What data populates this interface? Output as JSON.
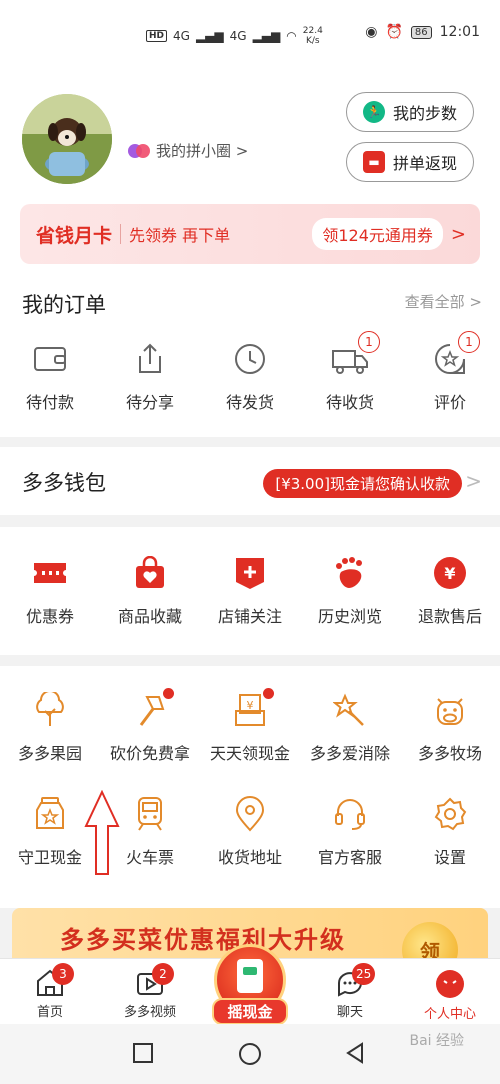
{
  "status_bar": {
    "network_left": "HD",
    "signal1": "4G",
    "signal2": "4G",
    "speed_value": "22.4",
    "speed_unit": "K/s",
    "battery": "86",
    "time": "12:01"
  },
  "profile": {
    "circle_link": "我的拼小圈 >",
    "steps_button": "我的步数",
    "cashback_button": "拼单返现",
    "vip": {
      "title": "省钱月卡",
      "subtitle": "先领券 再下单",
      "coupon": "领124元通用券",
      "arrow": ">"
    }
  },
  "orders": {
    "title": "我的订单",
    "view_all": "查看全部 >",
    "items": [
      {
        "label": "待付款",
        "icon": "wallet-icon",
        "badge": null
      },
      {
        "label": "待分享",
        "icon": "share-icon",
        "badge": null
      },
      {
        "label": "待发货",
        "icon": "clock-icon",
        "badge": null
      },
      {
        "label": "待收货",
        "icon": "truck-icon",
        "badge": "1"
      },
      {
        "label": "评价",
        "icon": "review-icon",
        "badge": "1"
      }
    ]
  },
  "wallet": {
    "title": "多多钱包",
    "notice": "[¥3.00]现金请您确认收款",
    "arrow": ">"
  },
  "services": {
    "items": [
      {
        "label": "优惠券",
        "icon": "ticket-icon"
      },
      {
        "label": "商品收藏",
        "icon": "bag-heart-icon"
      },
      {
        "label": "店铺关注",
        "icon": "store-plus-icon"
      },
      {
        "label": "历史浏览",
        "icon": "footprint-icon"
      },
      {
        "label": "退款售后",
        "icon": "refund-icon"
      }
    ]
  },
  "tools": {
    "row1": [
      {
        "label": "多多果园",
        "icon": "tree-icon",
        "dot": false
      },
      {
        "label": "砍价免费拿",
        "icon": "axe-icon",
        "dot": true
      },
      {
        "label": "天天领现金",
        "icon": "cash-icon",
        "dot": true
      },
      {
        "label": "多多爱消除",
        "icon": "star-wand-icon",
        "dot": false
      },
      {
        "label": "多多牧场",
        "icon": "cow-icon",
        "dot": false
      }
    ],
    "row2": [
      {
        "label": "守卫现金",
        "icon": "jar-icon",
        "dot": false
      },
      {
        "label": "火车票",
        "icon": "train-icon",
        "dot": false
      },
      {
        "label": "收货地址",
        "icon": "location-icon",
        "dot": false
      },
      {
        "label": "官方客服",
        "icon": "headset-icon",
        "dot": false
      },
      {
        "label": "设置",
        "icon": "gear-icon",
        "dot": false
      }
    ]
  },
  "banner": {
    "text": "多多买菜优惠福利大升级",
    "coin": "领"
  },
  "tabbar": {
    "items": [
      {
        "label": "首页",
        "badge": "3"
      },
      {
        "label": "多多视频",
        "badge": "2"
      },
      {
        "label": "摇现金",
        "badge": null
      },
      {
        "label": "聊天",
        "badge": "25"
      },
      {
        "label": "个人中心",
        "badge": null
      }
    ]
  },
  "watermark": "Bai 经验",
  "colors": {
    "accent": "#e02e24",
    "tool_orange": "#e38a2b"
  }
}
